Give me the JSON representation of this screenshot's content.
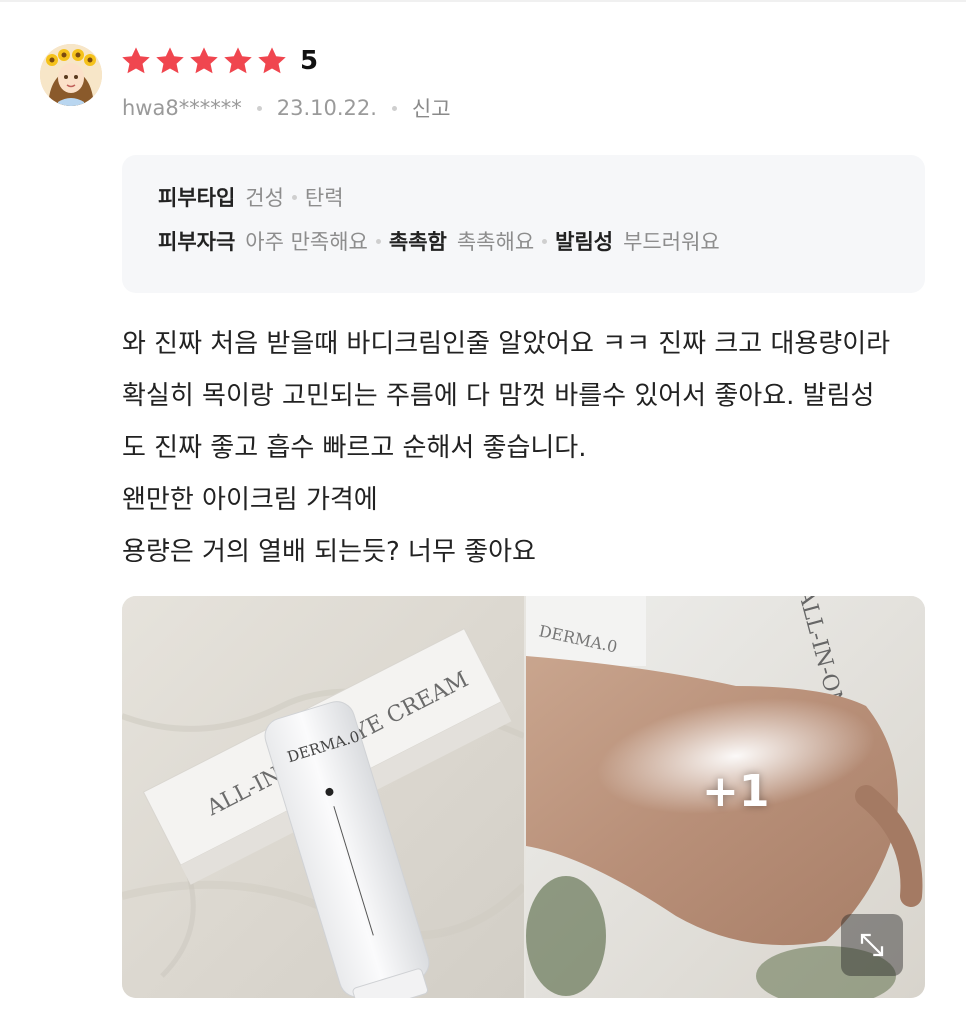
{
  "review": {
    "avatar_icon": "sunflower-girl-avatar",
    "rating": {
      "stars": 5,
      "value_label": "5",
      "star_color": "#f0464f"
    },
    "meta": {
      "user": "hwa8******",
      "date": "23.10.22.",
      "report_label": "신고"
    },
    "attributes": {
      "skin_type_label": "피부타입",
      "skin_type_values": [
        "건성",
        "탄력"
      ],
      "items": [
        {
          "key": "피부자극",
          "value": "아주 만족해요"
        },
        {
          "key": "촉촉함",
          "value": "촉촉해요"
        },
        {
          "key": "발림성",
          "value": "부드러워요"
        }
      ]
    },
    "text_lines": [
      "와 진짜 처음 받을때 바디크림인줄 알았어요 ㅋㅋ 진짜 크고 대용량이라",
      "확실히 목이랑 고민되는 주름에 다 맘껏 바를수 있어서 좋아요. 발림성",
      "도 진짜 좋고 흡수 빠르고 순해서 좋습니다.",
      "왠만한 아이크림 가격에",
      "용량은 거의 열배 되는듯? 너무 좋아요"
    ],
    "photos": {
      "photo1": {
        "box_text": "ALL-IN-ONE EYE CREAM",
        "tube_brand": "DERMA.0"
      },
      "photo2": {
        "box_text": "ALL-IN-ONE",
        "tube_brand": "DERMA.0"
      },
      "more_count_label": "+1",
      "expand_icon": "expand-arrows-icon"
    }
  }
}
